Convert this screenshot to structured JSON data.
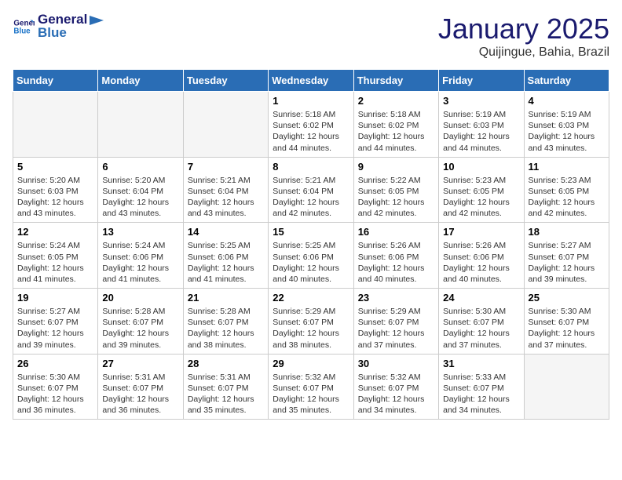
{
  "logo": {
    "line1": "General",
    "line2": "Blue"
  },
  "title": "January 2025",
  "subtitle": "Quijingue, Bahia, Brazil",
  "days_of_week": [
    "Sunday",
    "Monday",
    "Tuesday",
    "Wednesday",
    "Thursday",
    "Friday",
    "Saturday"
  ],
  "weeks": [
    [
      {
        "num": "",
        "info": ""
      },
      {
        "num": "",
        "info": ""
      },
      {
        "num": "",
        "info": ""
      },
      {
        "num": "1",
        "info": "Sunrise: 5:18 AM\nSunset: 6:02 PM\nDaylight: 12 hours\nand 44 minutes."
      },
      {
        "num": "2",
        "info": "Sunrise: 5:18 AM\nSunset: 6:02 PM\nDaylight: 12 hours\nand 44 minutes."
      },
      {
        "num": "3",
        "info": "Sunrise: 5:19 AM\nSunset: 6:03 PM\nDaylight: 12 hours\nand 44 minutes."
      },
      {
        "num": "4",
        "info": "Sunrise: 5:19 AM\nSunset: 6:03 PM\nDaylight: 12 hours\nand 43 minutes."
      }
    ],
    [
      {
        "num": "5",
        "info": "Sunrise: 5:20 AM\nSunset: 6:03 PM\nDaylight: 12 hours\nand 43 minutes."
      },
      {
        "num": "6",
        "info": "Sunrise: 5:20 AM\nSunset: 6:04 PM\nDaylight: 12 hours\nand 43 minutes."
      },
      {
        "num": "7",
        "info": "Sunrise: 5:21 AM\nSunset: 6:04 PM\nDaylight: 12 hours\nand 43 minutes."
      },
      {
        "num": "8",
        "info": "Sunrise: 5:21 AM\nSunset: 6:04 PM\nDaylight: 12 hours\nand 42 minutes."
      },
      {
        "num": "9",
        "info": "Sunrise: 5:22 AM\nSunset: 6:05 PM\nDaylight: 12 hours\nand 42 minutes."
      },
      {
        "num": "10",
        "info": "Sunrise: 5:23 AM\nSunset: 6:05 PM\nDaylight: 12 hours\nand 42 minutes."
      },
      {
        "num": "11",
        "info": "Sunrise: 5:23 AM\nSunset: 6:05 PM\nDaylight: 12 hours\nand 42 minutes."
      }
    ],
    [
      {
        "num": "12",
        "info": "Sunrise: 5:24 AM\nSunset: 6:05 PM\nDaylight: 12 hours\nand 41 minutes."
      },
      {
        "num": "13",
        "info": "Sunrise: 5:24 AM\nSunset: 6:06 PM\nDaylight: 12 hours\nand 41 minutes."
      },
      {
        "num": "14",
        "info": "Sunrise: 5:25 AM\nSunset: 6:06 PM\nDaylight: 12 hours\nand 41 minutes."
      },
      {
        "num": "15",
        "info": "Sunrise: 5:25 AM\nSunset: 6:06 PM\nDaylight: 12 hours\nand 40 minutes."
      },
      {
        "num": "16",
        "info": "Sunrise: 5:26 AM\nSunset: 6:06 PM\nDaylight: 12 hours\nand 40 minutes."
      },
      {
        "num": "17",
        "info": "Sunrise: 5:26 AM\nSunset: 6:06 PM\nDaylight: 12 hours\nand 40 minutes."
      },
      {
        "num": "18",
        "info": "Sunrise: 5:27 AM\nSunset: 6:07 PM\nDaylight: 12 hours\nand 39 minutes."
      }
    ],
    [
      {
        "num": "19",
        "info": "Sunrise: 5:27 AM\nSunset: 6:07 PM\nDaylight: 12 hours\nand 39 minutes."
      },
      {
        "num": "20",
        "info": "Sunrise: 5:28 AM\nSunset: 6:07 PM\nDaylight: 12 hours\nand 39 minutes."
      },
      {
        "num": "21",
        "info": "Sunrise: 5:28 AM\nSunset: 6:07 PM\nDaylight: 12 hours\nand 38 minutes."
      },
      {
        "num": "22",
        "info": "Sunrise: 5:29 AM\nSunset: 6:07 PM\nDaylight: 12 hours\nand 38 minutes."
      },
      {
        "num": "23",
        "info": "Sunrise: 5:29 AM\nSunset: 6:07 PM\nDaylight: 12 hours\nand 37 minutes."
      },
      {
        "num": "24",
        "info": "Sunrise: 5:30 AM\nSunset: 6:07 PM\nDaylight: 12 hours\nand 37 minutes."
      },
      {
        "num": "25",
        "info": "Sunrise: 5:30 AM\nSunset: 6:07 PM\nDaylight: 12 hours\nand 37 minutes."
      }
    ],
    [
      {
        "num": "26",
        "info": "Sunrise: 5:30 AM\nSunset: 6:07 PM\nDaylight: 12 hours\nand 36 minutes."
      },
      {
        "num": "27",
        "info": "Sunrise: 5:31 AM\nSunset: 6:07 PM\nDaylight: 12 hours\nand 36 minutes."
      },
      {
        "num": "28",
        "info": "Sunrise: 5:31 AM\nSunset: 6:07 PM\nDaylight: 12 hours\nand 35 minutes."
      },
      {
        "num": "29",
        "info": "Sunrise: 5:32 AM\nSunset: 6:07 PM\nDaylight: 12 hours\nand 35 minutes."
      },
      {
        "num": "30",
        "info": "Sunrise: 5:32 AM\nSunset: 6:07 PM\nDaylight: 12 hours\nand 34 minutes."
      },
      {
        "num": "31",
        "info": "Sunrise: 5:33 AM\nSunset: 6:07 PM\nDaylight: 12 hours\nand 34 minutes."
      },
      {
        "num": "",
        "info": ""
      }
    ]
  ]
}
